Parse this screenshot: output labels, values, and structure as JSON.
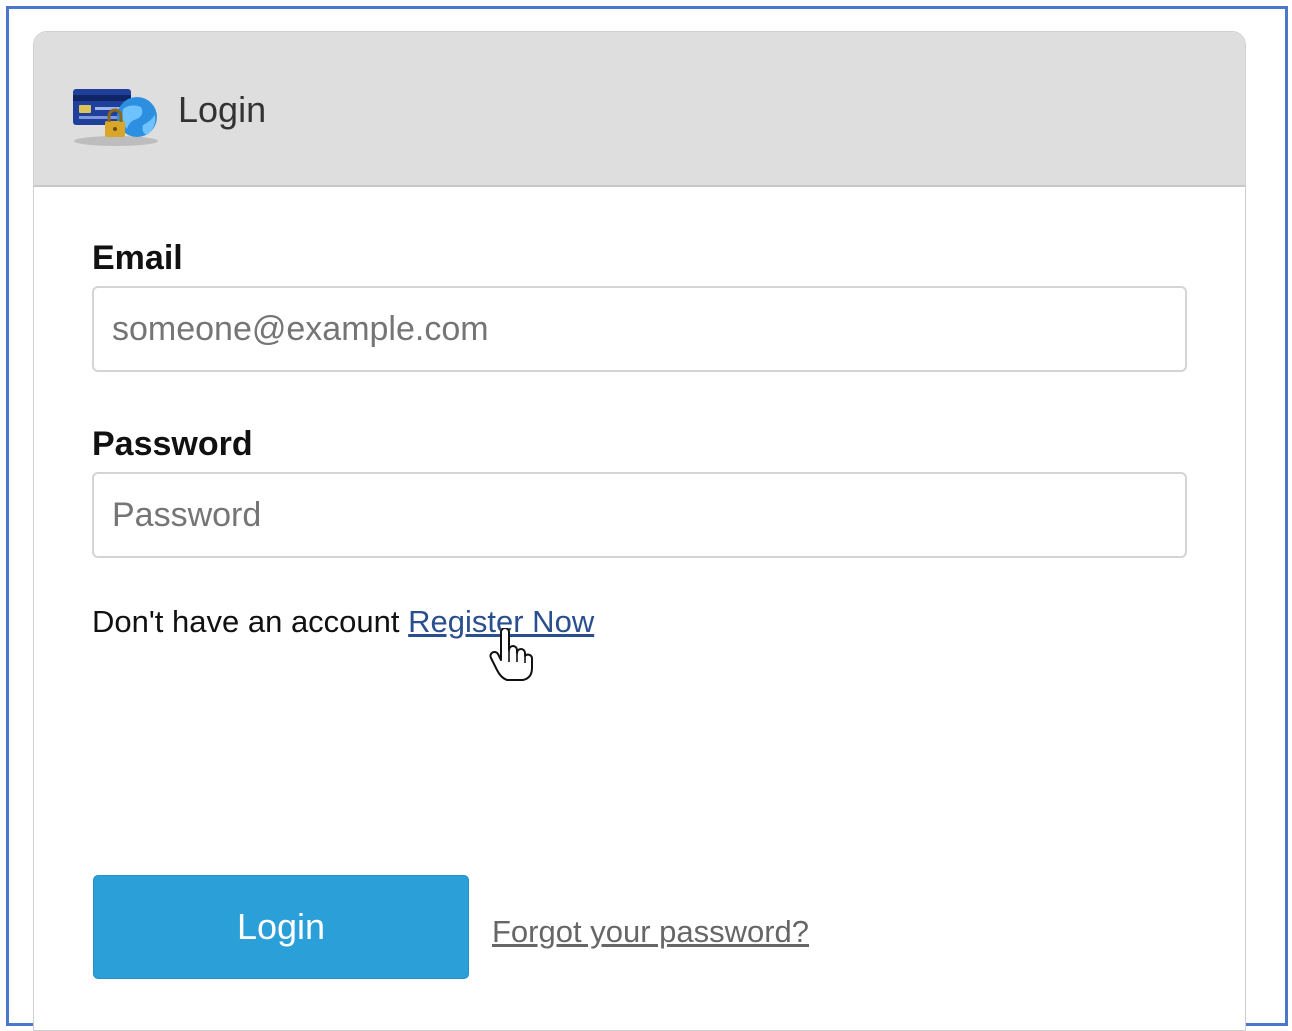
{
  "header": {
    "title": "Login",
    "icon": "credit-card-globe-lock-icon"
  },
  "form": {
    "email": {
      "label": "Email",
      "value": "",
      "placeholder": "someone@example.com"
    },
    "password": {
      "label": "Password",
      "value": "",
      "placeholder": "Password"
    },
    "register": {
      "prompt": "Don't have an account ",
      "link_label": "Register Now"
    },
    "login_button_label": "Login",
    "forgot_link_label": "Forgot your password?"
  },
  "colors": {
    "frame_border": "#4a77c9",
    "header_bg": "#dedede",
    "button_bg": "#2a9fd8",
    "link": "#2a4f8f"
  }
}
